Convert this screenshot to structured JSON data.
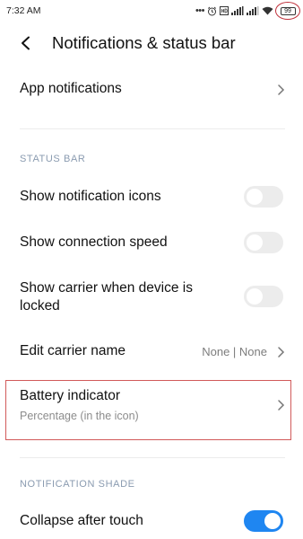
{
  "status_bar": {
    "time": "7:32 AM",
    "overflow": "•••",
    "icons": [
      "alarm-icon",
      "hd-icon",
      "signal-icon",
      "signal-icon",
      "wifi-icon",
      "battery-icon"
    ],
    "battery_level": "99",
    "highlight_color": "#c0303a"
  },
  "header": {
    "title": "Notifications & status bar",
    "back_icon": "back-arrow-icon"
  },
  "rows": {
    "app_notifications": {
      "label": "App notifications"
    },
    "show_notification_icons": {
      "label": "Show notification icons",
      "enabled": false
    },
    "show_connection_speed": {
      "label": "Show connection speed",
      "enabled": false
    },
    "show_carrier_locked": {
      "label_line1": "Show carrier when device is",
      "label_line2": "locked",
      "enabled": false
    },
    "edit_carrier_name": {
      "label": "Edit carrier name",
      "value": "None | None"
    },
    "battery_indicator": {
      "label": "Battery indicator",
      "subtitle": "Percentage (in the icon)"
    },
    "collapse_after_touch": {
      "label": "Collapse after touch",
      "enabled": true
    }
  },
  "sections": {
    "status_bar": "STATUS BAR",
    "notification_shade": "NOTIFICATION SHADE"
  },
  "colors": {
    "accent": "#1f86f1",
    "section_header": "#8a9bb0",
    "toggle_off": "#ececec",
    "highlight_box": "#d15a5a"
  }
}
